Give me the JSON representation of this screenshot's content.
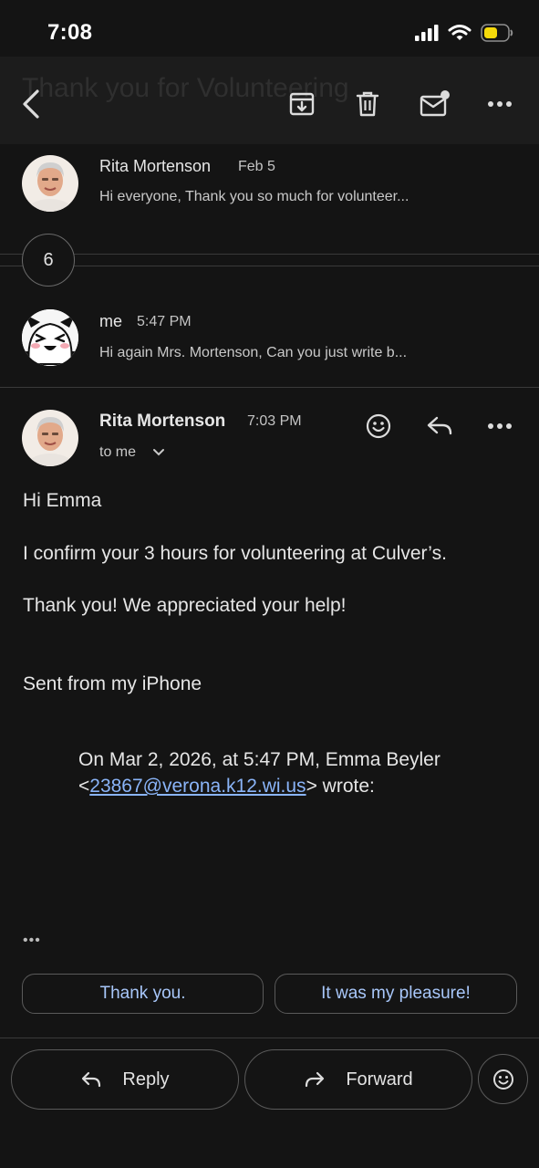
{
  "status_bar": {
    "time": "7:08"
  },
  "app_bar": {
    "ghost_title": "Thank you for Volunteering",
    "icons": [
      "back-arrow-icon",
      "archive-icon",
      "trash-icon",
      "mark-unread-icon",
      "more-icon"
    ]
  },
  "thread": {
    "first_message": {
      "sender": "Rita Mortenson",
      "date": "Feb 5",
      "snippet": "Hi everyone, Thank you so much for volunteer..."
    },
    "collapsed_count": "6",
    "my_message": {
      "sender": "me",
      "time": "5:47 PM",
      "snippet": "Hi again Mrs. Mortenson, Can you just write b..."
    },
    "open_message": {
      "sender": "Rita Mortenson",
      "time": "7:03 PM",
      "recipient": "to me",
      "body": [
        "Hi Emma",
        "I confirm your 3 hours for volunteering at Culver’s.",
        "Thank you!  We appreciated your help!",
        "Sent from my iPhone"
      ],
      "quote_prefix": "On Mar 2, 2026, at 5:47 PM, Emma Beyler <",
      "quote_email": "23867@verona.k12.wi.us",
      "quote_suffix": "> wrote:",
      "more_dots": "•••"
    }
  },
  "smart_replies": [
    "Thank you.",
    "It was my pleasure!"
  ],
  "bottom_actions": {
    "reply": "Reply",
    "forward": "Forward"
  }
}
